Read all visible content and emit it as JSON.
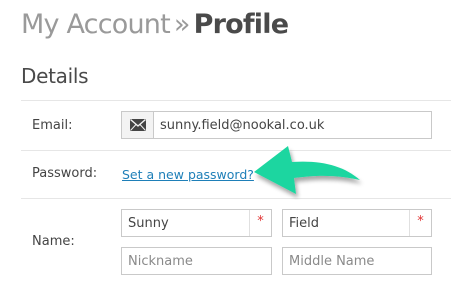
{
  "breadcrumb": {
    "parent": "My Account",
    "separator": "»",
    "current": "Profile"
  },
  "section": {
    "title": "Details"
  },
  "email": {
    "label": "Email:",
    "value": "sunny.field@nookal.co.uk",
    "icon": "envelope-icon"
  },
  "password": {
    "label": "Password:",
    "link": "Set a new password?"
  },
  "name": {
    "label": "Name:",
    "first": "Sunny",
    "last": "Field",
    "nickname_placeholder": "Nickname",
    "middle_placeholder": "Middle Name",
    "required_marker": "*"
  },
  "colors": {
    "link": "#1e7fb8",
    "arrow": "#1fd6a0",
    "required": "#e03030"
  }
}
